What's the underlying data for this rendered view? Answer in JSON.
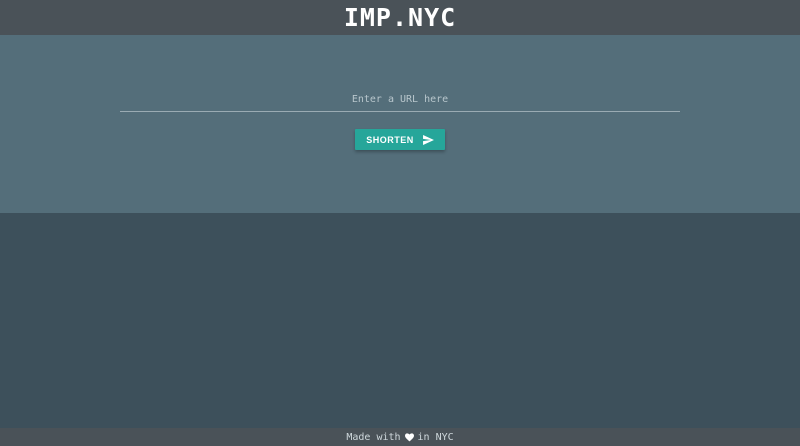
{
  "header": {
    "logo_text": "IMP.NYC"
  },
  "form": {
    "url_input": {
      "placeholder": "Enter a URL here",
      "value": ""
    },
    "submit": {
      "label": "SHORTEN",
      "icon": "send-icon"
    }
  },
  "footer": {
    "prefix": "Made with",
    "icon": "heart-icon",
    "suffix": "in NYC"
  },
  "colors": {
    "header_bg": "#4a5258",
    "hero_bg": "#546e7a",
    "body_bg": "#3d505b",
    "accent": "#26a69a"
  }
}
